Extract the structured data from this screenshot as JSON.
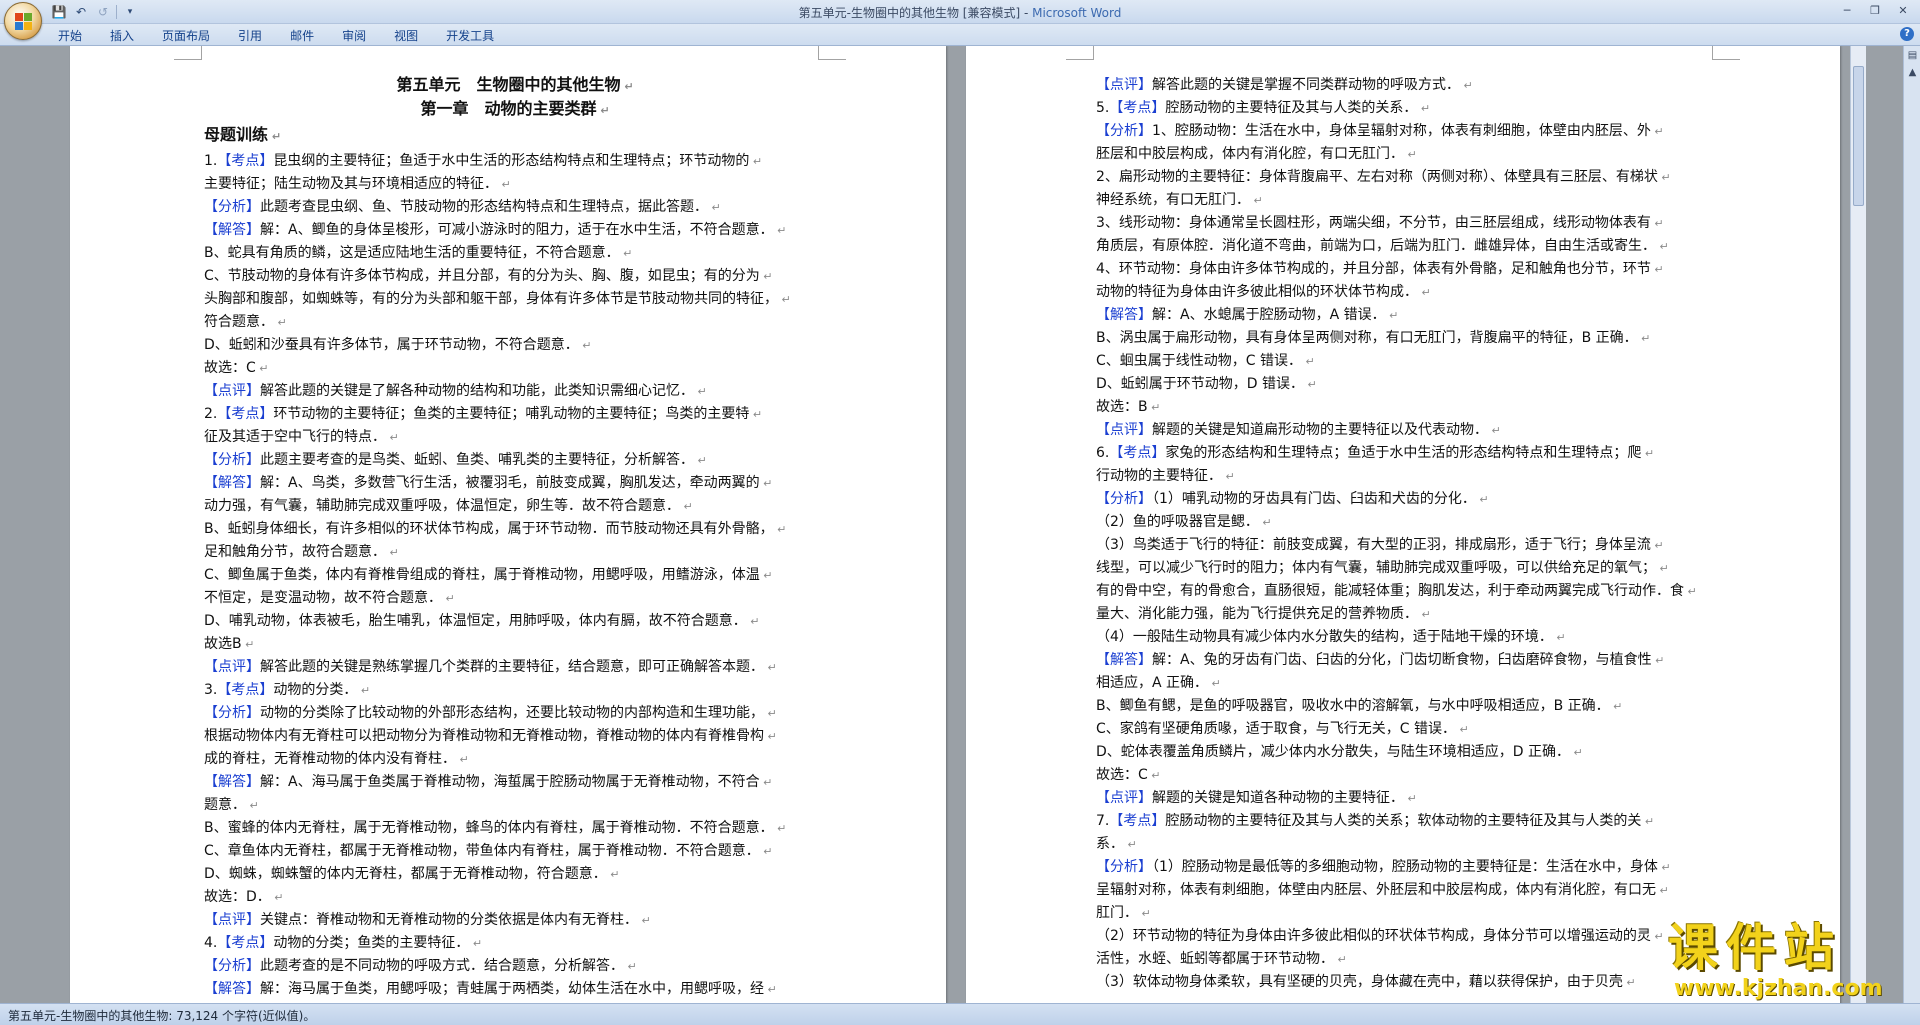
{
  "window": {
    "title": "第五单元-生物圈中的其他生物 [兼容模式] - ",
    "app": "Microsoft Word"
  },
  "ribbon": {
    "tabs": [
      "开始",
      "插入",
      "页面布局",
      "引用",
      "邮件",
      "审阅",
      "视图",
      "开发工具"
    ]
  },
  "status": {
    "text": "第五单元-生物圈中的其他生物: 73,124 个字符(近似值)。"
  },
  "watermark": {
    "main": "课件站",
    "url": "www.kjzhan.com"
  },
  "page1": {
    "lines": [
      {
        "tag": "",
        "text": "第五单元　生物圈中的其他生物",
        "cls": "h1"
      },
      {
        "tag": "",
        "text": "第一章　动物的主要类群",
        "cls": "h1"
      },
      {
        "tag": "",
        "text": "母题训练",
        "cls": "h2"
      },
      {
        "tag": "【考点】",
        "pre": "1.",
        "text": "昆虫纲的主要特征；鱼适于水中生活的形态结构特点和生理特点；环节动物的"
      },
      {
        "tag": "",
        "text": "主要特征；陆生动物及其与环境相适应的特征．"
      },
      {
        "tag": "【分析】",
        "text": "此题考查昆虫纲、鱼、节肢动物的形态结构特点和生理特点，据此答题．"
      },
      {
        "tag": "【解答】",
        "text": "解：A、鲫鱼的身体呈梭形，可减小游泳时的阻力，适于在水中生活，不符合题意．"
      },
      {
        "tag": "",
        "text": "B、蛇具有角质的鳞，这是适应陆地生活的重要特征，不符合题意．"
      },
      {
        "tag": "",
        "text": "C、节肢动物的身体有许多体节构成，并且分部，有的分为头、胸、腹，如昆虫；有的分为"
      },
      {
        "tag": "",
        "text": "头胸部和腹部，如蜘蛛等，有的分为头部和躯干部，身体有许多体节是节肢动物共同的特征，"
      },
      {
        "tag": "",
        "text": "符合题意．"
      },
      {
        "tag": "",
        "text": "D、蚯蚓和沙蚕具有许多体节，属于环节动物，不符合题意．"
      },
      {
        "tag": "",
        "text": "故选：C"
      },
      {
        "tag": "【点评】",
        "text": "解答此题的关键是了解各种动物的结构和功能，此类知识需细心记忆．"
      },
      {
        "tag": "【考点】",
        "pre": "2.",
        "text": "环节动物的主要特征；鱼类的主要特征；哺乳动物的主要特征；鸟类的主要特"
      },
      {
        "tag": "",
        "text": "征及其适于空中飞行的特点．"
      },
      {
        "tag": "【分析】",
        "text": "此题主要考查的是鸟类、蚯蚓、鱼类、哺乳类的主要特征，分析解答．"
      },
      {
        "tag": "【解答】",
        "text": "解：A、鸟类，多数营飞行生活，被覆羽毛，前肢变成翼，胸肌发达，牵动两翼的"
      },
      {
        "tag": "",
        "text": "动力强，有气囊，辅助肺完成双重呼吸，体温恒定，卵生等．故不符合题意．"
      },
      {
        "tag": "",
        "text": "B、蚯蚓身体细长，有许多相似的环状体节构成，属于环节动物．而节肢动物还具有外骨骼，"
      },
      {
        "tag": "",
        "text": "足和触角分节，故符合题意．"
      },
      {
        "tag": "",
        "text": "C、鲫鱼属于鱼类，体内有脊椎骨组成的脊柱，属于脊椎动物，用鳃呼吸，用鳍游泳，体温"
      },
      {
        "tag": "",
        "text": "不恒定，是变温动物，故不符合题意．"
      },
      {
        "tag": "",
        "text": "D、哺乳动物，体表被毛，胎生哺乳，体温恒定，用肺呼吸，体内有膈，故不符合题意．"
      },
      {
        "tag": "",
        "text": "故选B"
      },
      {
        "tag": "【点评】",
        "text": "解答此题的关键是熟练掌握几个类群的主要特征，结合题意，即可正确解答本题．"
      },
      {
        "tag": "【考点】",
        "pre": "3.",
        "text": "动物的分类．"
      },
      {
        "tag": "【分析】",
        "text": "动物的分类除了比较动物的外部形态结构，还要比较动物的内部构造和生理功能，"
      },
      {
        "tag": "",
        "text": "根据动物体内有无脊柱可以把动物分为脊椎动物和无脊椎动物，脊椎动物的体内有脊椎骨构"
      },
      {
        "tag": "",
        "text": "成的脊柱，无脊椎动物的体内没有脊柱．"
      },
      {
        "tag": "【解答】",
        "text": "解：A、海马属于鱼类属于脊椎动物，海蜇属于腔肠动物属于无脊椎动物，不符合"
      },
      {
        "tag": "",
        "text": "题意．"
      },
      {
        "tag": "",
        "text": "B、蜜蜂的体内无脊柱，属于无脊椎动物，蜂鸟的体内有脊柱，属于脊椎动物．不符合题意．"
      },
      {
        "tag": "",
        "text": "C、章鱼体内无脊柱，都属于无脊椎动物，带鱼体内有脊柱，属于脊椎动物．不符合题意．"
      },
      {
        "tag": "",
        "text": "D、蜘蛛，蜘蛛蟹的体内无脊柱，都属于无脊椎动物，符合题意．"
      },
      {
        "tag": "",
        "text": "故选：D．"
      },
      {
        "tag": "【点评】",
        "text": "关键点：脊椎动物和无脊椎动物的分类依据是体内有无脊柱．"
      },
      {
        "tag": "【考点】",
        "pre": "4.",
        "text": "动物的分类；鱼类的主要特征．"
      },
      {
        "tag": "【分析】",
        "text": "此题考查的是不同动物的呼吸方式．结合题意，分析解答．"
      },
      {
        "tag": "【解答】",
        "text": "解：海马属于鱼类，用鳃呼吸；青蛙属于两栖类，幼体生活在水中，用鳃呼吸，经"
      }
    ]
  },
  "page2": {
    "lines": [
      {
        "tag": "【点评】",
        "text": "解答此题的关键是掌握不同类群动物的呼吸方式．"
      },
      {
        "tag": "【考点】",
        "pre": "5.",
        "text": "腔肠动物的主要特征及其与人类的关系．"
      },
      {
        "tag": "【分析】",
        "text": "1、腔肠动物：生活在水中，身体呈辐射对称，体表有刺细胞，体壁由内胚层、外"
      },
      {
        "tag": "",
        "text": "胚层和中胶层构成，体内有消化腔，有口无肛门．"
      },
      {
        "tag": "",
        "text": "2、扁形动物的主要特征：身体背腹扁平、左右对称（两侧对称）、体壁具有三胚层、有梯状"
      },
      {
        "tag": "",
        "text": "神经系统，有口无肛门．"
      },
      {
        "tag": "",
        "text": "3、线形动物：身体通常呈长圆柱形，两端尖细，不分节，由三胚层组成，线形动物体表有"
      },
      {
        "tag": "",
        "text": "角质层，有原体腔．消化道不弯曲，前端为口，后端为肛门．雌雄异体，自由生活或寄生．"
      },
      {
        "tag": "",
        "text": "4、环节动物：身体由许多体节构成的，并且分部，体表有外骨骼，足和触角也分节，环节"
      },
      {
        "tag": "",
        "text": "动物的特征为身体由许多彼此相似的环状体节构成．"
      },
      {
        "tag": "【解答】",
        "text": "解：A、水螅属于腔肠动物，A 错误．"
      },
      {
        "tag": "",
        "text": "B、涡虫属于扁形动物，具有身体呈两侧对称，有口无肛门，背腹扁平的特征，B 正确．"
      },
      {
        "tag": "",
        "text": "C、蛔虫属于线性动物，C 错误．"
      },
      {
        "tag": "",
        "text": "D、蚯蚓属于环节动物，D 错误．"
      },
      {
        "tag": "",
        "text": "故选：B"
      },
      {
        "tag": "【点评】",
        "text": "解题的关键是知道扁形动物的主要特征以及代表动物．"
      },
      {
        "tag": "【考点】",
        "pre": "6.",
        "text": "家兔的形态结构和生理特点；鱼适于水中生活的形态结构特点和生理特点；爬"
      },
      {
        "tag": "",
        "text": "行动物的主要特征．"
      },
      {
        "tag": "【分析】",
        "text": "（1）哺乳动物的牙齿具有门齿、臼齿和犬齿的分化．"
      },
      {
        "tag": "",
        "text": "（2）鱼的呼吸器官是鳃．"
      },
      {
        "tag": "",
        "text": "（3）鸟类适于飞行的特征：前肢变成翼，有大型的正羽，排成扇形，适于飞行；身体呈流"
      },
      {
        "tag": "",
        "text": "线型，可以减少飞行时的阻力；体内有气囊，辅助肺完成双重呼吸，可以供给充足的氧气；"
      },
      {
        "tag": "",
        "text": "有的骨中空，有的骨愈合，直肠很短，能减轻体重；胸肌发达，利于牵动两翼完成飞行动作．食"
      },
      {
        "tag": "",
        "text": "量大、消化能力强，能为飞行提供充足的营养物质．"
      },
      {
        "tag": "",
        "text": "（4）一般陆生动物具有减少体内水分散失的结构，适于陆地干燥的环境．"
      },
      {
        "tag": "【解答】",
        "text": "解：A、兔的牙齿有门齿、臼齿的分化，门齿切断食物，臼齿磨碎食物，与植食性"
      },
      {
        "tag": "",
        "text": "相适应，A 正确．"
      },
      {
        "tag": "",
        "text": "B、鲫鱼有鳃，是鱼的呼吸器官，吸收水中的溶解氧，与水中呼吸相适应，B 正确．"
      },
      {
        "tag": "",
        "text": "C、家鸽有坚硬角质喙，适于取食，与飞行无关，C 错误．"
      },
      {
        "tag": "",
        "text": "D、蛇体表覆盖角质鳞片，减少体内水分散失，与陆生环境相适应，D 正确．"
      },
      {
        "tag": "",
        "text": "故选：C"
      },
      {
        "tag": "【点评】",
        "text": "解题的关键是知道各种动物的主要特征．"
      },
      {
        "tag": "【考点】",
        "pre": "7.",
        "text": "腔肠动物的主要特征及其与人类的关系；软体动物的主要特征及其与人类的关"
      },
      {
        "tag": "",
        "text": "系．"
      },
      {
        "tag": "【分析】",
        "text": "（1）腔肠动物是最低等的多细胞动物，腔肠动物的主要特征是：生活在水中，身体"
      },
      {
        "tag": "",
        "text": "呈辐射对称，体表有刺细胞，体壁由内胚层、外胚层和中胶层构成，体内有消化腔，有口无"
      },
      {
        "tag": "",
        "text": "肛门．"
      },
      {
        "tag": "",
        "text": "（2）环节动物的特征为身体由许多彼此相似的环状体节构成，身体分节可以增强运动的灵"
      },
      {
        "tag": "",
        "text": "活性，水蛭、蚯蚓等都属于环节动物．"
      },
      {
        "tag": "",
        "text": "（3）软体动物身体柔软，具有坚硬的贝壳，身体藏在壳中，藉以获得保护，由于贝壳"
      }
    ]
  }
}
